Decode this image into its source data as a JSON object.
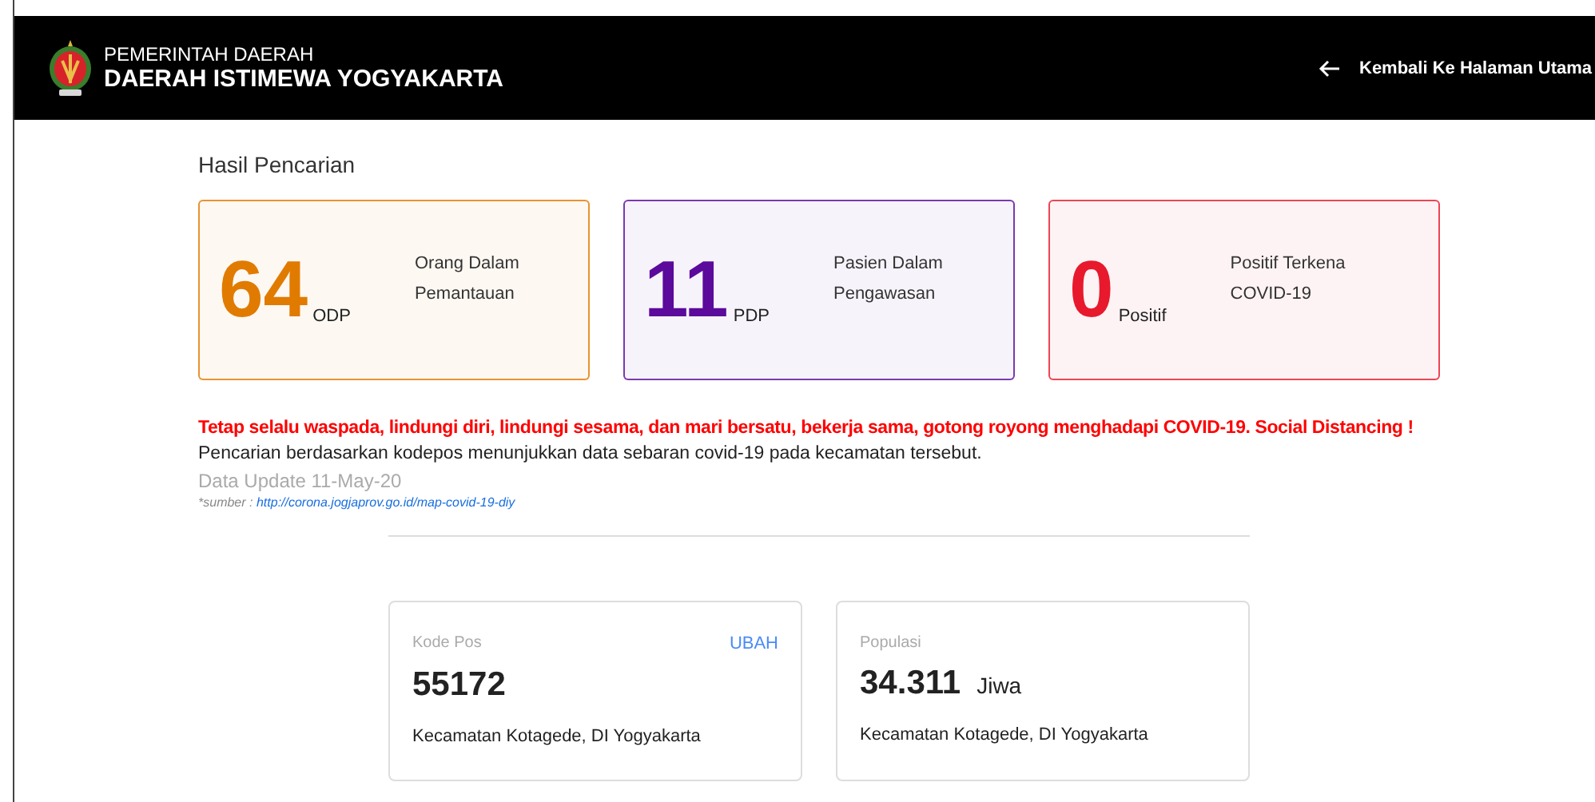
{
  "header": {
    "subtitle": "PEMERINTAH DAERAH",
    "title": "DAERAH ISTIMEWA YOGYAKARTA",
    "back_link": "Kembali Ke Halaman Utama"
  },
  "section_title": "Hasil Pencarian",
  "stats": [
    {
      "count": "64",
      "unit": "ODP",
      "description": "Orang Dalam Pemantauan",
      "color": "#e07b00"
    },
    {
      "count": "11",
      "unit": "PDP",
      "description": "Pasien Dalam Pengawasan",
      "color": "#5b0a9c"
    },
    {
      "count": "0",
      "unit": "Positif",
      "description": "Positif Terkena COVID-19",
      "color": "#e8192c"
    }
  ],
  "warning": "Tetap selalu waspada, lindungi diri, lindungi sesama, dan mari bersatu, bekerja sama, gotong royong menghadapi COVID-19. Social Distancing !",
  "description": "Pencarian berdasarkan kodepos menunjukkan data sebaran covid-19 pada kecamatan tersebut.",
  "update": "Data Update 11-May-20",
  "source": {
    "label": "*sumber :",
    "link": "http://corona.jogjaprov.go.id/map-covid-19-diy"
  },
  "info_cards": [
    {
      "label": "Kode Pos",
      "action": "UBAH",
      "value": "55172",
      "location": "Kecamatan Kotagede, DI Yogyakarta"
    },
    {
      "label": "Populasi",
      "value": "34.311",
      "unit": "Jiwa",
      "location": "Kecamatan Kotagede, DI Yogyakarta"
    }
  ]
}
